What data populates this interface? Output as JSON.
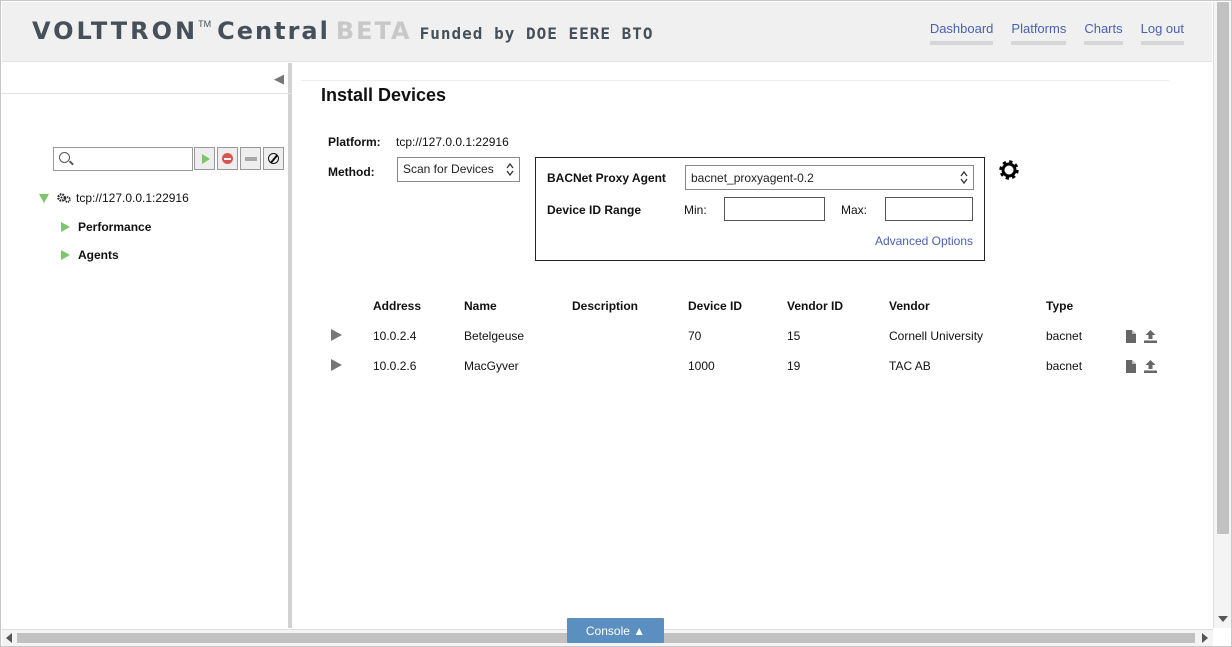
{
  "header": {
    "brand_volttron": "VOLTTRON",
    "brand_tm": "TM",
    "brand_central": "Central",
    "brand_beta": "BETA",
    "brand_funded": "Funded by DOE EERE BTO",
    "nav": {
      "dashboard": "Dashboard",
      "platforms": "Platforms",
      "charts": "Charts",
      "logout": "Log out"
    }
  },
  "sidebar": {
    "filter_placeholder": "",
    "tree": {
      "platform": "tcp://127.0.0.1:22916",
      "performance": "Performance",
      "agents": "Agents"
    }
  },
  "main": {
    "title": "Install Devices",
    "platform_label": "Platform:",
    "platform_value": "tcp://127.0.0.1:22916",
    "method_label": "Method:",
    "method_value": "Scan for Devices",
    "bacnet": {
      "proxy_label": "BACNet Proxy Agent",
      "proxy_value": "bacnet_proxyagent-0.2",
      "range_label": "Device ID Range",
      "min_label": "Min:",
      "max_label": "Max:",
      "min_value": "",
      "max_value": "",
      "advanced": "Advanced Options"
    },
    "table": {
      "headers": {
        "address": "Address",
        "name": "Name",
        "description": "Description",
        "device_id": "Device ID",
        "vendor_id": "Vendor ID",
        "vendor": "Vendor",
        "type": "Type"
      },
      "rows": [
        {
          "address": "10.0.2.4",
          "name": "Betelgeuse",
          "description": "",
          "device_id": "70",
          "vendor_id": "15",
          "vendor": "Cornell University",
          "type": "bacnet"
        },
        {
          "address": "10.0.2.6",
          "name": "MacGyver",
          "description": "",
          "device_id": "1000",
          "vendor_id": "19",
          "vendor": "TAC AB",
          "type": "bacnet"
        }
      ]
    }
  },
  "console": {
    "label": "Console ▲"
  },
  "colors": {
    "link": "#4a5fb0",
    "tree_arrow": "#7cc56a",
    "console_bg": "#5b8fc0",
    "stop_red": "#d9534f"
  }
}
